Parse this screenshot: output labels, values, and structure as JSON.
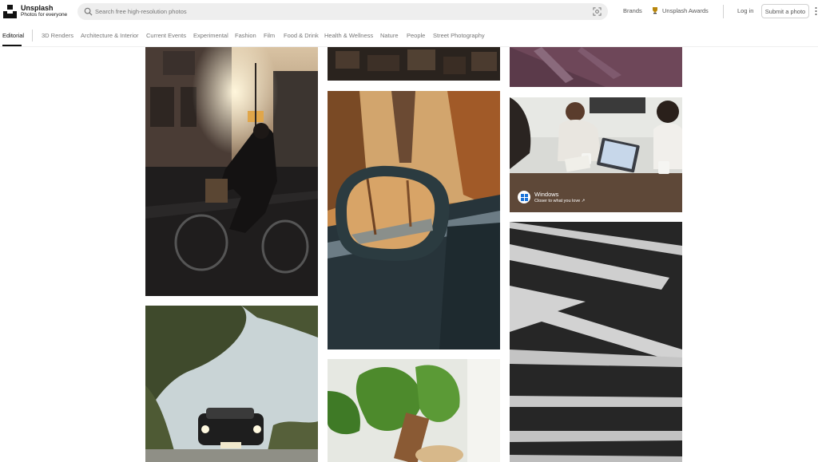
{
  "brand": {
    "name": "Unsplash",
    "tagline": "Photos for everyone"
  },
  "search": {
    "placeholder": "Search free high-resolution photos",
    "value": ""
  },
  "header_nav": {
    "brands": "Brands",
    "awards": "Unsplash Awards",
    "login": "Log in",
    "submit": "Submit a photo"
  },
  "tabs": {
    "active": "Editorial",
    "items": [
      "3D Renders",
      "Architecture & Interior",
      "Current Events",
      "Experimental",
      "Fashion",
      "Film",
      "Food & Drink",
      "Health & Wellness",
      "Nature",
      "People",
      "Street Photography"
    ]
  },
  "ad": {
    "title": "Windows",
    "subtitle": "Closer to what you love ↗"
  },
  "photos": [
    {
      "name": "cyclist-street-sunset"
    },
    {
      "name": "vintage-car-trees"
    },
    {
      "name": "stacked-wood-texture"
    },
    {
      "name": "car-side-mirror-autumn"
    },
    {
      "name": "green-plant-leaves"
    },
    {
      "name": "purple-abstract"
    },
    {
      "name": "windows-ad-meeting"
    },
    {
      "name": "crosswalk-stripes"
    }
  ],
  "colors": {
    "accent": "#111111",
    "search_bg": "#eeeeee",
    "ad_blue": "#1a73d9"
  }
}
